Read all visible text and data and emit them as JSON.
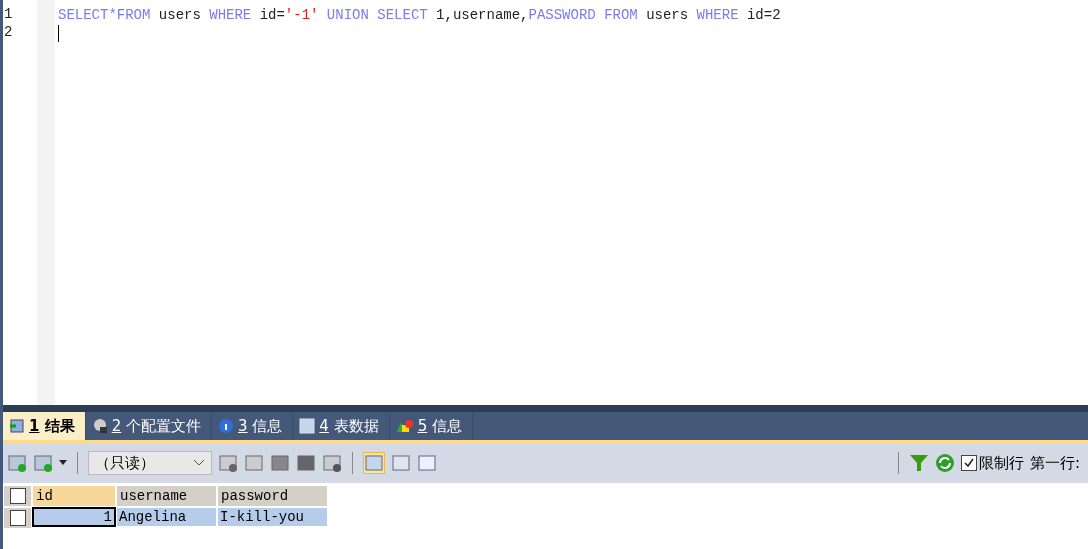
{
  "editor": {
    "lines": [
      {
        "number": "1",
        "tokens": [
          {
            "kind": "keyword",
            "text": "SELECT*FROM"
          },
          {
            "kind": "plain",
            "text": " users "
          },
          {
            "kind": "keyword",
            "text": "WHERE"
          },
          {
            "kind": "plain",
            "text": " id="
          },
          {
            "kind": "string",
            "text": "'-1'"
          },
          {
            "kind": "keyword",
            "text": " UNION SELECT"
          },
          {
            "kind": "plain",
            "text": " 1,username,"
          },
          {
            "kind": "keyword",
            "text": "PASSWORD FROM"
          },
          {
            "kind": "plain",
            "text": " users "
          },
          {
            "kind": "keyword",
            "text": "WHERE"
          },
          {
            "kind": "plain",
            "text": " id=2"
          }
        ]
      },
      {
        "number": "2",
        "cursor": true
      }
    ]
  },
  "tabs": [
    {
      "num": "1",
      "label": "结果",
      "selected": true
    },
    {
      "num": "2",
      "label": "个配置文件",
      "selected": false
    },
    {
      "num": "3",
      "label": "信息",
      "selected": false
    },
    {
      "num": "4",
      "label": "表数据",
      "selected": false
    },
    {
      "num": "5",
      "label": "信息",
      "selected": false
    }
  ],
  "toolbar": {
    "mode": "（只读）",
    "limit_rows": {
      "label": "限制行",
      "checked": true
    },
    "first_row_label": "第一行:"
  },
  "grid": {
    "all_selected": false,
    "columns": [
      "id",
      "username",
      "password"
    ],
    "rows": [
      {
        "selected": true,
        "checked": false,
        "cells": [
          "1",
          "Angelina",
          "I-kill-you"
        ]
      }
    ]
  }
}
